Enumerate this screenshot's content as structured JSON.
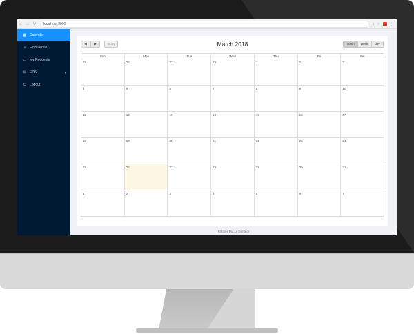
{
  "browser": {
    "url": "localhost:3000",
    "back_icon": "arrow-left-icon",
    "forward_icon": "arrow-right-icon",
    "reload_icon": "reload-icon"
  },
  "sidebar": {
    "items": [
      {
        "label": "Calendar",
        "icon": "calendar-icon",
        "active": true
      },
      {
        "label": "Find Venue",
        "icon": "search-icon"
      },
      {
        "label": "My Requests",
        "icon": "folder-icon"
      },
      {
        "label": "EPK",
        "icon": "grid-icon",
        "expandable": true
      },
      {
        "label": "Logout",
        "icon": "power-icon"
      }
    ]
  },
  "calendar": {
    "title": "March 2018",
    "prev_label": "◀",
    "next_label": "▶",
    "today_label": "today",
    "views": {
      "month": "month",
      "week": "week",
      "day": "day"
    },
    "active_view": "month",
    "days_of_week": [
      "Sun",
      "Mon",
      "Tue",
      "Wed",
      "Thu",
      "Fri",
      "Sat"
    ],
    "weeks": [
      [
        "25",
        "26",
        "27",
        "28",
        "1",
        "2",
        "3"
      ],
      [
        "4",
        "5",
        "6",
        "7",
        "8",
        "9",
        "10"
      ],
      [
        "11",
        "12",
        "13",
        "14",
        "15",
        "16",
        "17"
      ],
      [
        "18",
        "19",
        "20",
        "21",
        "22",
        "23",
        "24"
      ],
      [
        "25",
        "26",
        "27",
        "28",
        "29",
        "30",
        "31"
      ],
      [
        "1",
        "2",
        "3",
        "4",
        "5",
        "6",
        "7"
      ]
    ],
    "highlight": {
      "week": 4,
      "day": 1
    }
  },
  "footer": {
    "text": "Rubber Ducky Donator"
  },
  "colors": {
    "sidebar": "#001a33",
    "accent": "#1890ff",
    "today": "#fcf8e3"
  }
}
